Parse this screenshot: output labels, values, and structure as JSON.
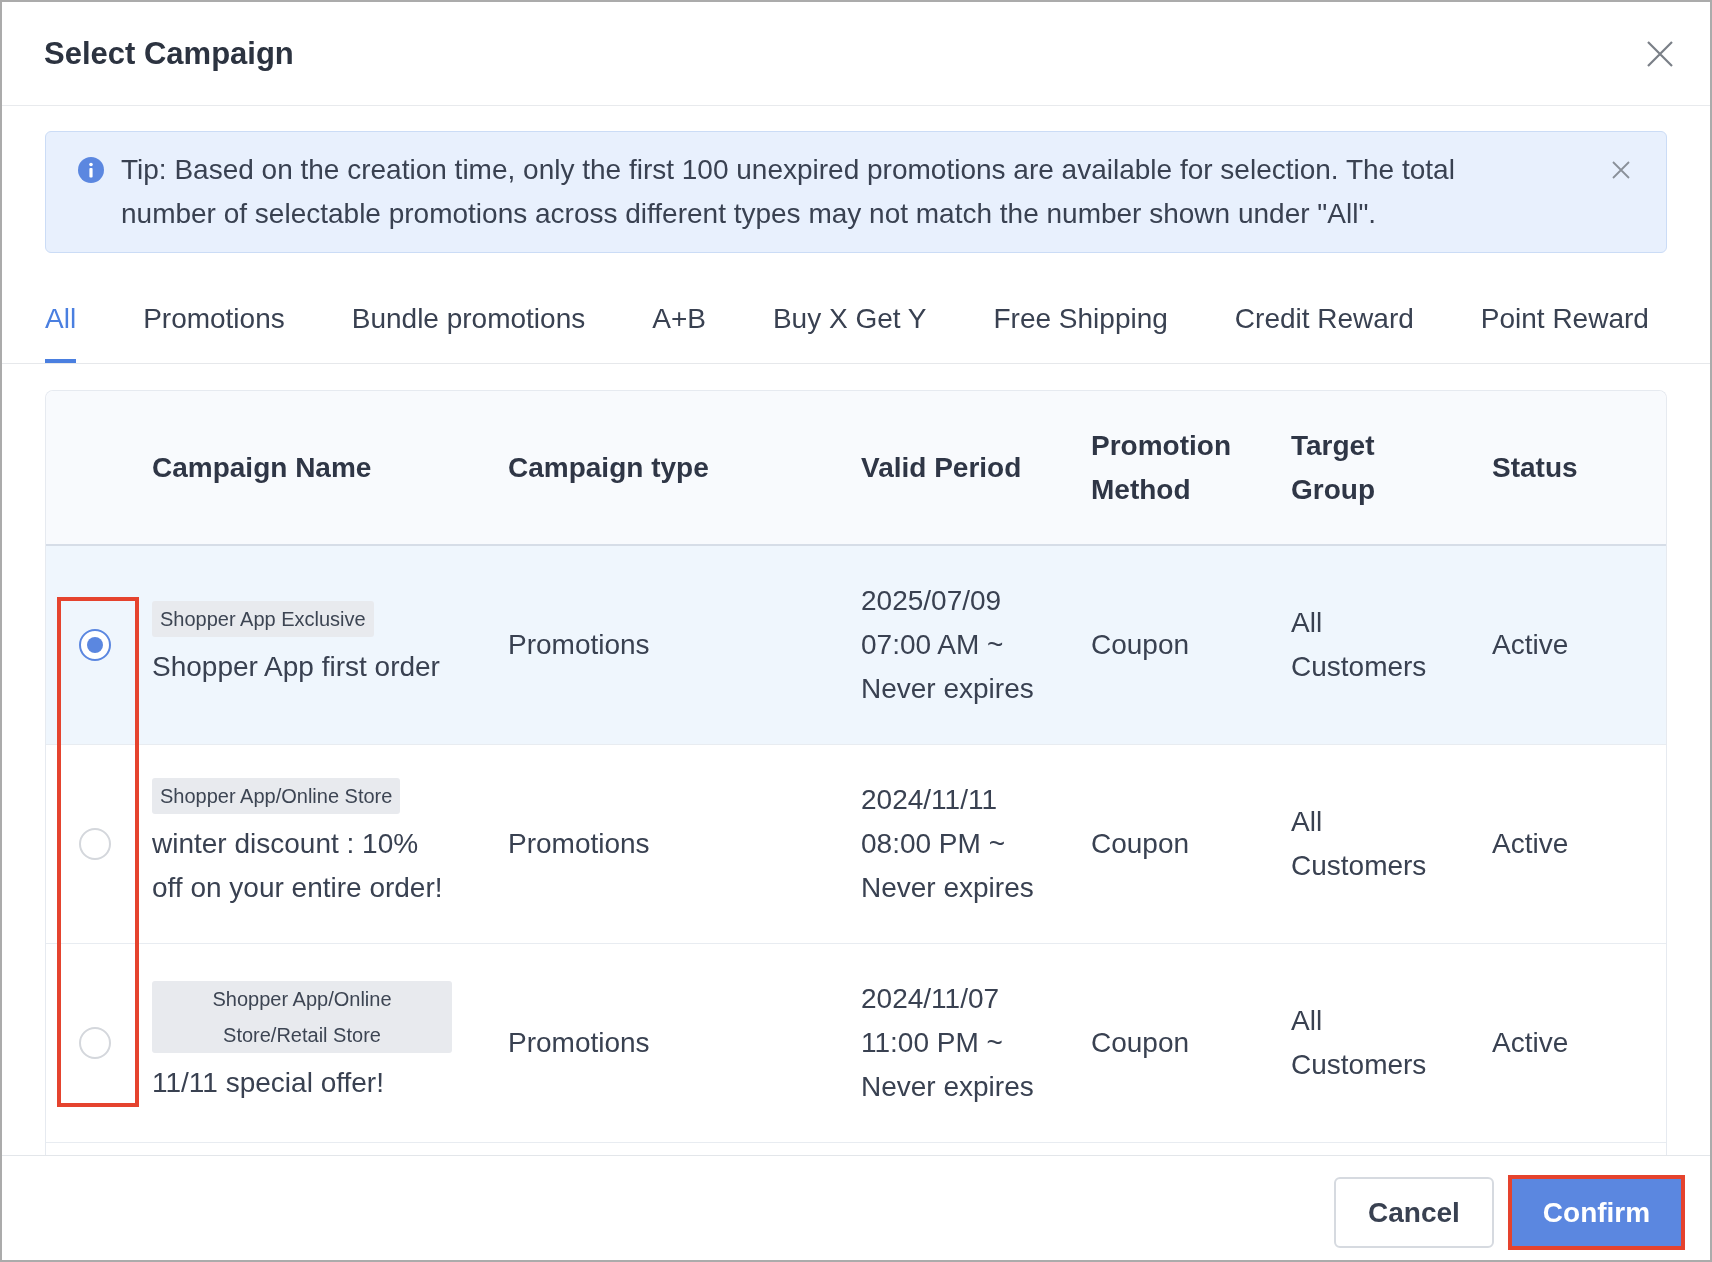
{
  "dialog": {
    "title": "Select Campaign"
  },
  "tip": {
    "text": "Tip: Based on the creation time, only the first 100 unexpired promotions are available for selection. The total number of selectable promotions across different types may not match the number shown under \"All\"."
  },
  "tabs": [
    {
      "label": "All",
      "selected": true
    },
    {
      "label": "Promotions",
      "selected": false
    },
    {
      "label": "Bundle promotions",
      "selected": false
    },
    {
      "label": "A+B",
      "selected": false
    },
    {
      "label": "Buy X Get Y",
      "selected": false
    },
    {
      "label": "Free Shipping",
      "selected": false
    },
    {
      "label": "Credit Reward",
      "selected": false
    },
    {
      "label": "Point Reward",
      "selected": false
    }
  ],
  "table": {
    "columns": [
      "Campaign Name",
      "Campaign type",
      "Valid Period",
      "Promotion Method",
      "Target Group",
      "Status"
    ],
    "radio_column_highlighted": true,
    "rows": [
      {
        "selected": true,
        "tag": "Shopper App Exclusive",
        "name": "Shopper App first order",
        "type": "Promotions",
        "valid_period": "2025/07/09 07:00 AM ~ Never expires",
        "method": "Coupon",
        "target_group": "All Customers",
        "status": "Active"
      },
      {
        "selected": false,
        "tag": "Shopper App/Online Store",
        "name": "winter discount : 10% off on your entire order!",
        "type": "Promotions",
        "valid_period": "2024/11/11 08:00 PM ~ Never expires",
        "method": "Coupon",
        "target_group": "All Customers",
        "status": "Active"
      },
      {
        "selected": false,
        "tag": "Shopper App/Online Store/Retail Store",
        "name": "11/11 special offer!",
        "type": "Promotions",
        "valid_period": "2024/11/07 11:00 PM ~ Never expires",
        "method": "Coupon",
        "target_group": "All Customers",
        "status": "Active"
      }
    ]
  },
  "buttons": [
    {
      "label": "Cancel",
      "kind": "secondary",
      "highlighted": false
    },
    {
      "label": "Confirm",
      "kind": "primary",
      "highlighted": true
    }
  ]
}
